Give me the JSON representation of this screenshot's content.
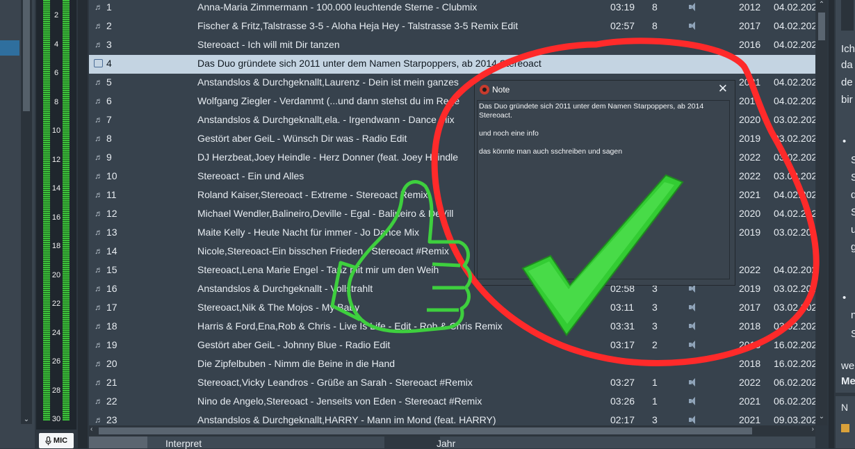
{
  "left_pane": {
    "scroll_arrow": "⌄"
  },
  "meter": {
    "scale": [
      "2",
      "4",
      "6",
      "8",
      "10",
      "12",
      "14",
      "16",
      "18",
      "20",
      "22",
      "24",
      "26",
      "28",
      "30"
    ],
    "mic_label": "MIC",
    "mic_icon": "microphone-icon"
  },
  "tracks": [
    {
      "num": "1",
      "title": "Anna-Maria Zimmermann - 100.000 leuchtende Sterne - Clubmix",
      "duration": "03:19",
      "rating": "8",
      "year": "2012",
      "date": "04.02.202"
    },
    {
      "num": "2",
      "title": "Fischer & Fritz,Talstrasse 3-5 - Aloha Heja Hey - Talstrasse 3-5 Remix Edit",
      "duration": "02:57",
      "rating": "8",
      "year": "2017",
      "date": "04.02.202"
    },
    {
      "num": "3",
      "title": "Stereoact - Ich will mit Dir tanzen",
      "duration": "",
      "rating": "",
      "year": "2016",
      "date": "04.02.202"
    },
    {
      "num": "4",
      "title": "Das Duo gründete sich 2011 unter dem Namen Starpoppers, ab 2014 Stereoact",
      "duration": "",
      "rating": "",
      "year": "",
      "date": "",
      "type": "note"
    },
    {
      "num": "5",
      "title": "Anstandslos & Durchgeknallt,Laurenz - Dein ist mein ganzes",
      "duration": "",
      "rating": "",
      "year": "2021",
      "date": "04.02.202"
    },
    {
      "num": "6",
      "title": "Wolfgang Ziegler - Verdammt (...und dann stehst du im Rege",
      "duration": "",
      "rating": "",
      "year": "2013",
      "date": "04.02.202"
    },
    {
      "num": "7",
      "title": "Anstandslos & Durchgeknallt,ela. - Irgendwann - Dance Mix",
      "duration": "",
      "rating": "",
      "year": "2020",
      "date": "03.02.202"
    },
    {
      "num": "8",
      "title": "Gestört aber GeiL - Wünsch Dir was - Radio Edit",
      "duration": "",
      "rating": "",
      "year": "2019",
      "date": "03.02.202"
    },
    {
      "num": "9",
      "title": "DJ Herzbeat,Joey Heindle - Herz Donner (feat. Joey Heindle",
      "duration": "",
      "rating": "",
      "year": "2022",
      "date": "03.02.202"
    },
    {
      "num": "10",
      "title": "Stereoact - Ein und Alles",
      "duration": "",
      "rating": "",
      "year": "2022",
      "date": "03.02.202"
    },
    {
      "num": "11",
      "title": "Roland Kaiser,Stereoact - Extreme - Stereoact Remix",
      "duration": "",
      "rating": "",
      "year": "2021",
      "date": "04.02.202"
    },
    {
      "num": "12",
      "title": "Michael Wendler,Balineiro,Deville - Egal - Balineiro & DeVill",
      "duration": "",
      "rating": "",
      "year": "2020",
      "date": "04.02.202"
    },
    {
      "num": "13",
      "title": "Maite Kelly - Heute Nacht für immer - Jo  Dance Mix",
      "duration": "",
      "rating": "",
      "year": "2019",
      "date": "03.02.202"
    },
    {
      "num": "14",
      "title": "Nicole,Stereoact-Ein bisschen Frieden - Stereoact #Remix",
      "duration": "",
      "rating": "",
      "year": "",
      "date": ""
    },
    {
      "num": "15",
      "title": "Stereoact,Lena Marie Engel - Tanz mit mir um den Weih",
      "duration": "",
      "rating": "",
      "year": "2022",
      "date": "04.02.202"
    },
    {
      "num": "16",
      "title": "Anstandslos & Durchgeknallt - Vollstrahlt",
      "duration": "02:58",
      "rating": "3",
      "year": "2019",
      "date": "03.02.202"
    },
    {
      "num": "17",
      "title": "Stereoact,Nik & The Mojos - My Baby",
      "duration": "03:11",
      "rating": "3",
      "year": "2017",
      "date": "03.02.202"
    },
    {
      "num": "18",
      "title": "Harris & Ford,Ena,Rob & Chris - Live Is Life - Edit - Rob & Chris Remix",
      "duration": "03:31",
      "rating": "3",
      "year": "2018",
      "date": "03.02.202"
    },
    {
      "num": "19",
      "title": "Gestört aber GeiL - Johnny Blue - Radio Edit",
      "duration": "03:17",
      "rating": "2",
      "year": "2013",
      "date": "16.02.202"
    },
    {
      "num": "20",
      "title": "Die Zipfelbuben - Nimm die Beine in die Hand",
      "duration": "",
      "rating": "",
      "year": "2018",
      "date": "16.02.202"
    },
    {
      "num": "21",
      "title": "Stereoact,Vicky Leandros - Grüße an Sarah - Stereoact #Remix",
      "duration": "03:27",
      "rating": "1",
      "year": "2022",
      "date": "06.02.202"
    },
    {
      "num": "22",
      "title": "Nino de Angelo,Stereoact - Jenseits von Eden - Stereoact #Remix",
      "duration": "03:26",
      "rating": "1",
      "year": "2021",
      "date": "06.02.202"
    },
    {
      "num": "23",
      "title": "Anstandslos & Durchgeknallt,HARRY - Mann im Mond (feat. HARRY)",
      "duration": "02:17",
      "rating": "3",
      "year": "2021",
      "date": "09.03.202"
    }
  ],
  "icons": {
    "track": "music-note-icon",
    "note": "note-icon",
    "speaker": "speaker-icon"
  },
  "headers": {
    "col1": "Interpret",
    "col2": "Jahr"
  },
  "note_dialog": {
    "title": "Note",
    "close": "✕",
    "lines": [
      "Das Duo gründete sich 2011 unter dem Namen Starpoppers, ab 2014 Stereoact.",
      "und noch eine info",
      "das könnte man auch sschreiben und sagen"
    ]
  },
  "right_panel": {
    "lines": [
      "Ich",
      "da",
      "de",
      "bir",
      "•",
      "S",
      "S",
      "d",
      "S",
      "u",
      "g",
      "•",
      "n",
      "S",
      "we",
      "Me"
    ],
    "bottom_tab": "N"
  },
  "overlay": {
    "circle_color": "#ff2a2a",
    "check_color": "#33cc33",
    "thumb_color": "#3ecf3e"
  }
}
